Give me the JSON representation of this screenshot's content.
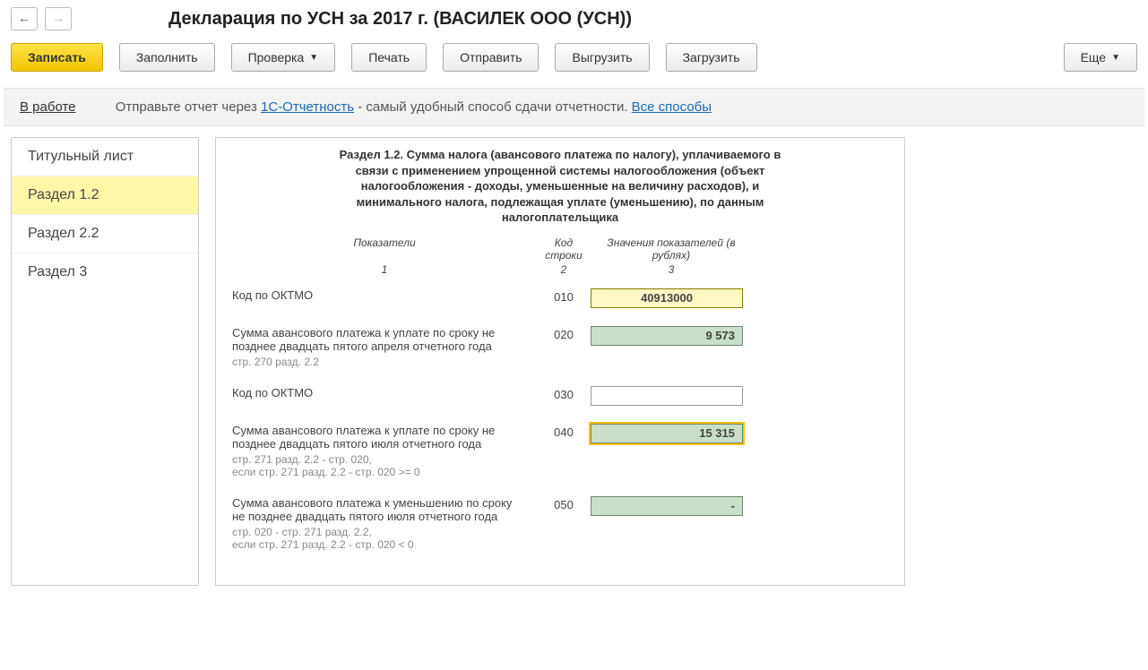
{
  "header": {
    "title": "Декларация по УСН за 2017 г. (ВАСИЛЕК ООО (УСН))"
  },
  "toolbar": {
    "save": "Записать",
    "fill": "Заполнить",
    "check": "Проверка",
    "print": "Печать",
    "send": "Отправить",
    "export": "Выгрузить",
    "import": "Загрузить",
    "more": "Еще"
  },
  "info": {
    "status": "В работе",
    "text1": "Отправьте отчет через ",
    "link1": "1С-Отчетность",
    "text2": " - самый удобный способ сдачи отчетности. ",
    "link2": "Все способы"
  },
  "sidenav": {
    "items": [
      {
        "label": "Титульный лист"
      },
      {
        "label": "Раздел 1.2"
      },
      {
        "label": "Раздел 2.2"
      },
      {
        "label": "Раздел 3"
      }
    ]
  },
  "section": {
    "title": "Раздел 1.2. Сумма налога (авансового платежа по налогу), уплачиваемого в связи с применением упрощенной системы налогообложения (объект налогообложения - доходы, уменьшенные на величину расходов), и минимального налога, подлежащая уплате (уменьшению), по данным налогоплательщика",
    "col_desc": "Показатели",
    "col_code": "Код строки",
    "col_val": "Значения показателей (в рублях)",
    "n1": "1",
    "n2": "2",
    "n3": "3"
  },
  "rows": {
    "r010": {
      "desc": "Код по ОКТМО",
      "code": "010",
      "value": "40913000"
    },
    "r020": {
      "desc": "Сумма авансового платежа к уплате по сроку не позднее двадцать пятого апреля отчетного года",
      "note": "стр. 270 разд. 2.2",
      "code": "020",
      "value": "9 573"
    },
    "r030": {
      "desc": "Код по ОКТМО",
      "code": "030",
      "value": ""
    },
    "r040": {
      "desc": "Сумма  авансового платежа к уплате по сроку не позднее двадцать пятого июля отчетного года",
      "note": "стр. 271 разд. 2.2 - стр. 020,\nесли стр. 271 разд. 2.2 - стр. 020 >= 0",
      "code": "040",
      "value": "15 315"
    },
    "r050": {
      "desc": "Сумма авансового платежа к уменьшению по сроку не позднее двадцать пятого июля отчетного года",
      "note": "стр. 020 - стр. 271 разд. 2.2,\nесли стр. 271 разд. 2.2 - стр. 020 < 0",
      "code": "050",
      "value": "-"
    }
  }
}
